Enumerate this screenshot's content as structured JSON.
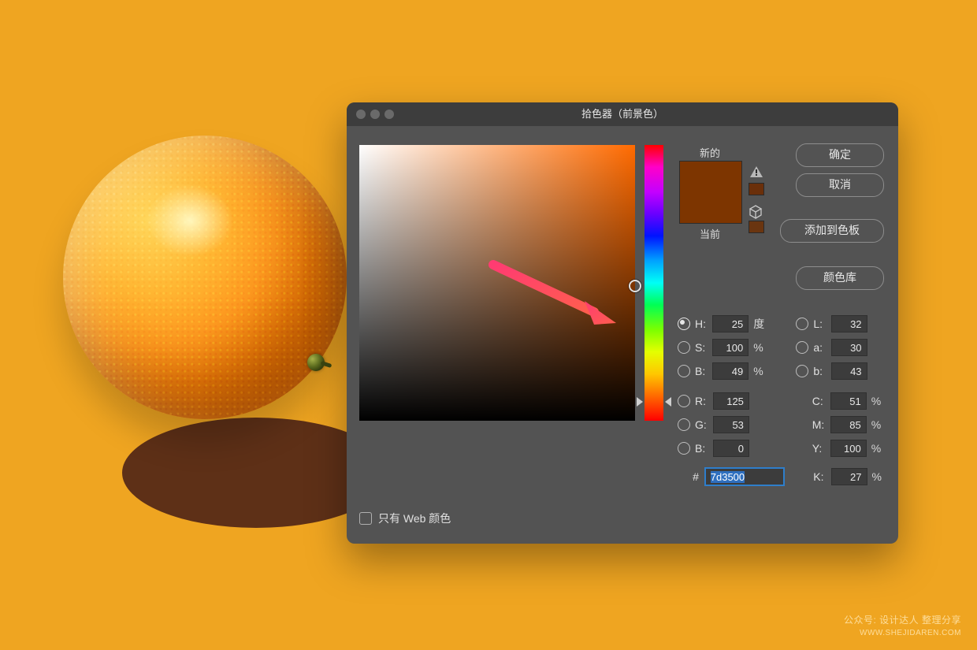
{
  "dialog": {
    "title": "拾色器（前景色）",
    "buttons": {
      "ok": "确定",
      "cancel": "取消",
      "add_swatch": "添加到色板",
      "color_lib": "颜色库"
    },
    "swatch": {
      "new_label": "新的",
      "current_label": "当前",
      "new_color": "#7d3500",
      "current_color": "#7d3500",
      "warn_color": "#6a2f0a",
      "cube_color": "#6a3510"
    },
    "web_only": "只有 Web 颜色",
    "hue_deg": 25,
    "sat_pct": 100,
    "bri_pct": 49,
    "fields": {
      "H": {
        "value": "25",
        "unit": "度",
        "radio": true,
        "selected": true
      },
      "S": {
        "value": "100",
        "unit": "%",
        "radio": true,
        "selected": false
      },
      "Bh": {
        "value": "49",
        "unit": "%",
        "radio": true,
        "selected": false
      },
      "R": {
        "value": "125",
        "unit": "",
        "radio": true,
        "selected": false
      },
      "G": {
        "value": "53",
        "unit": "",
        "radio": true,
        "selected": false
      },
      "Bv": {
        "value": "0",
        "unit": "",
        "radio": true,
        "selected": false
      },
      "L": {
        "value": "32",
        "unit": "",
        "radio": true,
        "selected": false
      },
      "a": {
        "value": "30",
        "unit": "",
        "radio": true,
        "selected": false
      },
      "b": {
        "value": "43",
        "unit": "",
        "radio": true,
        "selected": false
      },
      "C": {
        "value": "51",
        "unit": "%"
      },
      "M": {
        "value": "85",
        "unit": "%"
      },
      "Y": {
        "value": "100",
        "unit": "%"
      },
      "K": {
        "value": "27",
        "unit": "%"
      },
      "hex": {
        "value": "7d3500"
      }
    },
    "labels": {
      "H": "H:",
      "S": "S:",
      "B": "B:",
      "R": "R:",
      "G": "G:",
      "L": "L:",
      "a": "a:",
      "b": "b:",
      "C": "C:",
      "M": "M:",
      "Y": "Y:",
      "K": "K:",
      "hash": "#"
    }
  },
  "watermark": {
    "line1": "公众号: 设计达人 整理分享",
    "line2": "WWW.SHEJIDAREN.COM"
  }
}
